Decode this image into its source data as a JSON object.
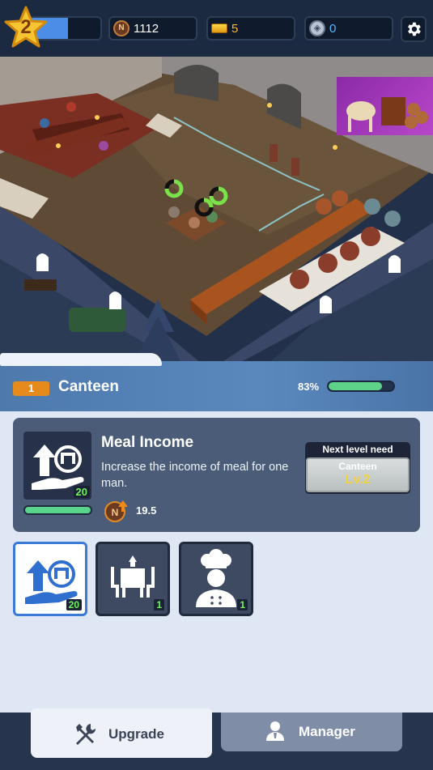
{
  "hud": {
    "level": "2",
    "xp_progress": 0.55,
    "coins": "1112",
    "gold": "5",
    "gems": "0",
    "icons": [
      "star-icon",
      "coin-icon",
      "gold-bar-icon",
      "gem-icon",
      "gear-icon"
    ]
  },
  "panel": {
    "level_badge": "1",
    "title": "Canteen",
    "progress_text": "83%",
    "progress": 0.83
  },
  "upgrade_card": {
    "title": "Meal Income",
    "description": "Increase the income of meal for one man.",
    "level": "20",
    "income_value": "19.5",
    "next_level_label": "Next level need",
    "requirement_name": "Canteen",
    "requirement_level": "Lv.2"
  },
  "slots": [
    {
      "icon": "coin-hand-upgrade-icon",
      "level": "20"
    },
    {
      "icon": "dining-table-icon",
      "level": "1"
    },
    {
      "icon": "chef-icon",
      "level": "1"
    }
  ],
  "tabs": {
    "upgrade": "Upgrade",
    "manager": "Manager"
  },
  "colors": {
    "accent_blue": "#4a8ee8",
    "progress_green": "#5fd28a",
    "badge_orange": "#e68a1c",
    "level_green": "#6ef35a",
    "requirement_gold": "#f4d23a"
  }
}
